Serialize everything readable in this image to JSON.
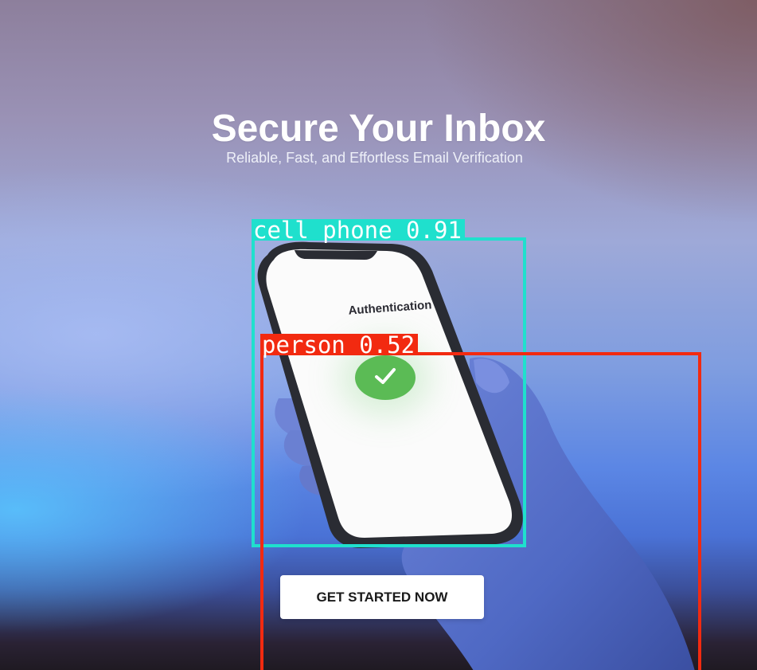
{
  "hero": {
    "title": "Secure Your Inbox",
    "subtitle": "Reliable, Fast, and Effortless Email Verification"
  },
  "phone_screen": {
    "title": "Authentication",
    "status_icon": "check-circle-icon"
  },
  "cta": {
    "label": "GET STARTED NOW"
  },
  "detections": [
    {
      "label": "cell phone 0.91",
      "color": "#1fe0cd"
    },
    {
      "label": "person 0.52",
      "color": "#f22a10"
    }
  ],
  "colors": {
    "check_green": "#5bbb55",
    "button_bg": "#ffffff"
  }
}
